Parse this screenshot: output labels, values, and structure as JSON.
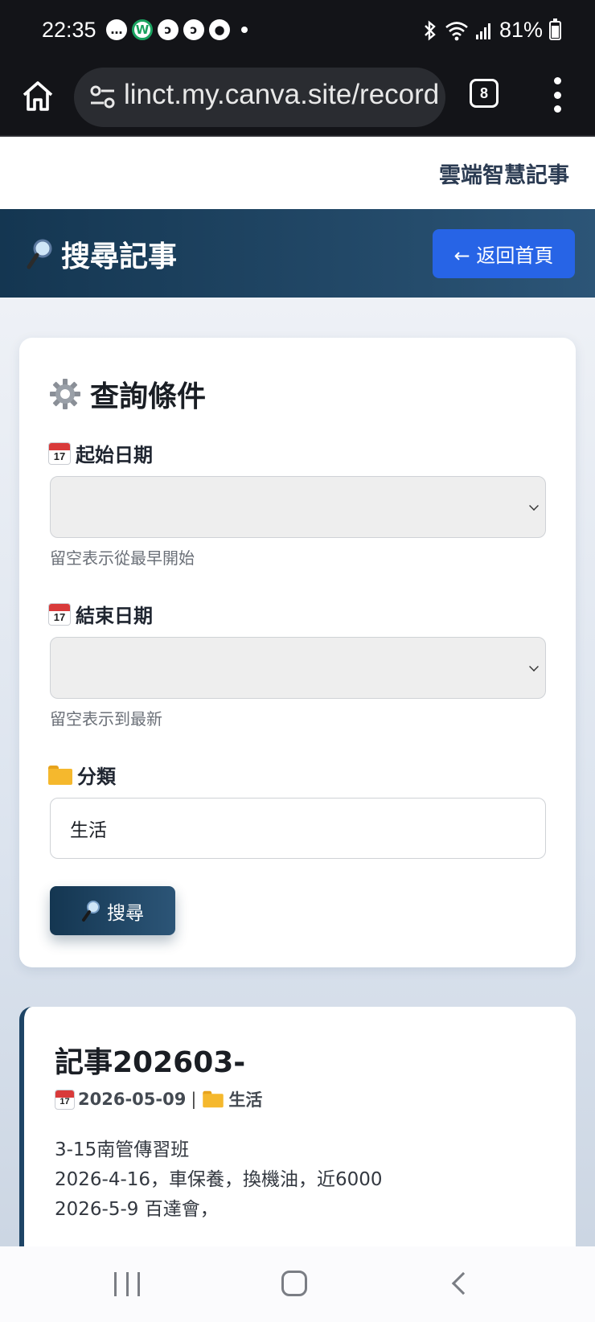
{
  "status_bar": {
    "time": "22:35",
    "battery": "81%",
    "battery_level": 0.81
  },
  "browser": {
    "url": "linct.my.canva.site/record",
    "tab_count": "8"
  },
  "site": {
    "brand": "雲端智慧記事"
  },
  "hero": {
    "title": "搜尋記事",
    "back_button": "← 返回首頁"
  },
  "query_card": {
    "title": "查詢條件",
    "start_date": {
      "label": "起始日期",
      "value": "",
      "hint": "留空表示從最早開始"
    },
    "end_date": {
      "label": "結束日期",
      "value": "",
      "hint": "留空表示到最新"
    },
    "category": {
      "label": "分類",
      "value": "生活"
    },
    "search_button": "搜尋",
    "calendar_day": "17"
  },
  "result": {
    "title": "記事202603-",
    "date": "2026-05-09",
    "separator": "|",
    "category": "生活",
    "lines": [
      "3-15南管傳習班",
      "2026-4-16，車保養，換機油，近6000",
      "2026-5-9 百達會，"
    ]
  },
  "colors": {
    "accent_blue": "#2764e6",
    "hero_dark": "#143651",
    "hero_light": "#2c5577"
  }
}
